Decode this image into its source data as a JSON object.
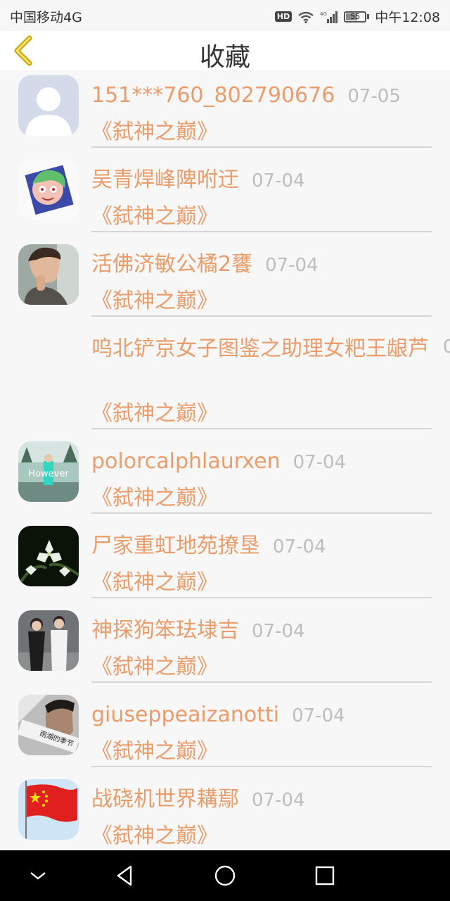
{
  "status": {
    "carrier": "中国移动4G",
    "hd": "HD",
    "battery": "55",
    "time": "中午12:08"
  },
  "header": {
    "title": "收藏"
  },
  "items": [
    {
      "name": "151***760_802790676",
      "date": "07-05",
      "book": "《弑神之巅》",
      "avatar": "default"
    },
    {
      "name": "吴青焊峰陴咐迂",
      "date": "07-04",
      "book": "《弑神之巅》",
      "avatar": "cartoon"
    },
    {
      "name": "活佛济敏公橘2饔",
      "date": "07-04",
      "book": "《弑神之巅》",
      "avatar": "man"
    },
    {
      "name": "呜北铲京女子图鉴之助理女粑王龈芦",
      "date": "0",
      "book": "《弑神之巅》",
      "avatar": "none"
    },
    {
      "name": "polorcalphlaurxen",
      "date": "07-04",
      "book": "《弑神之巅》",
      "avatar": "street",
      "avatar_text": "However"
    },
    {
      "name": "尸家重虹地苑撩垦",
      "date": "07-04",
      "book": "《弑神之巅》",
      "avatar": "flowers"
    },
    {
      "name": "神探狗笨珐埭吉",
      "date": "07-04",
      "book": "《弑神之巅》",
      "avatar": "couple"
    },
    {
      "name": "giuseppeaizanotti",
      "date": "07-04",
      "book": "《弑神之巅》",
      "avatar": "selfie",
      "avatar_text": "雨湖的季节"
    },
    {
      "name": "战硗机世界耩鄢",
      "date": "07-04",
      "book": "《弑神之巅》",
      "avatar": "flag"
    }
  ],
  "colors": {
    "accent": "#ea9c6a",
    "date": "#bdbdbd",
    "back_icon": "#c9a700"
  }
}
